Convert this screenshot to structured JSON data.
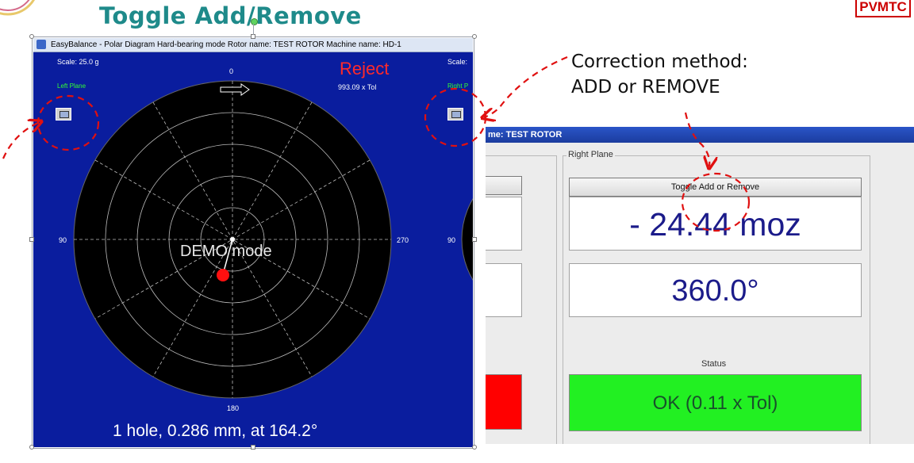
{
  "slide": {
    "title": "Toggle Add/Remove",
    "brand_badge": "PVMTC",
    "callout_line1": "Correction method:",
    "callout_line2": "ADD or REMOVE"
  },
  "polar_window": {
    "title_bar": "EasyBalance - Polar Diagram   Hard-bearing mode   Rotor name: TEST ROTOR   Machine name: HD-1",
    "scale_left": "Scale: 25.0 g",
    "scale_right": "Scale:",
    "left_plane_label": "Left Plane",
    "right_plane_label": "Right P",
    "status_word": "Reject",
    "tolerance_text": "993.09 x Tol",
    "angle_top": "0",
    "angle_left": "90",
    "angle_right": "270",
    "angle_bottom": "180",
    "right_diagram_angle": "90",
    "demo_text": "DEMO mode",
    "correction_text": "1 hole, 0.286 mm, at 164.2°",
    "colors": {
      "background": "#0a1d9e",
      "reject": "#ff2a2a",
      "plane_label": "#33ff33"
    }
  },
  "results_window": {
    "title_bar": "me: TEST ROTOR",
    "group_label": "Right Plane",
    "toggle_button": "Toggle Add or Remove",
    "amount": "- 24.44 moz",
    "angle": "360.0°",
    "status_label": "Status",
    "status_value": "OK (0.11 x Tol)",
    "colors": {
      "ok": "#22f022",
      "bad": "#ff0000",
      "value_text": "#1b1b8a"
    }
  }
}
